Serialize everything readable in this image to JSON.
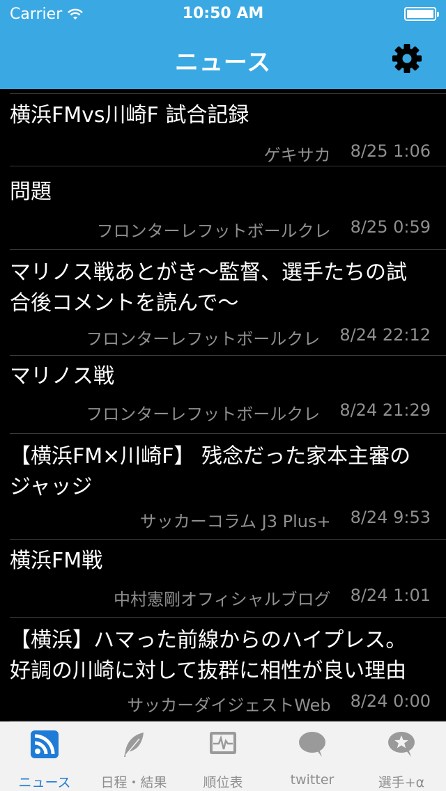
{
  "status_bar": {
    "carrier": "Carrier",
    "time": "10:50 AM"
  },
  "nav": {
    "title": "ニュース",
    "settings_icon": "gear-icon"
  },
  "news": [
    {
      "title": "横浜FMvs川崎F 試合記録",
      "source": "ゲキサカ",
      "date": "8/25 1:06"
    },
    {
      "title": "問題",
      "source": "フロンターレフットボールクレ",
      "date": "8/25 0:59"
    },
    {
      "title_lines": [
        "マリノス戦あとがき〜監督、選手たちの試",
        "合後コメントを読んで〜"
      ],
      "source": "フロンターレフットボールクレ",
      "date": "8/24 22:12"
    },
    {
      "title": "マリノス戦",
      "source": "フロンターレフットボールクレ",
      "date": "8/24 21:29"
    },
    {
      "title_lines": [
        "【横浜FM×川崎F】 残念だった家本主審の",
        "ジャッジ"
      ],
      "source": "サッカーコラム J3 Plus+",
      "date": "8/24 9:53"
    },
    {
      "title": "横浜FM戦",
      "source": "中村憲剛オフィシャルブログ",
      "date": "8/24 1:01"
    },
    {
      "title_lines": [
        "【横浜】ハマった前線からのハイプレス。",
        "好調の川崎に対して抜群に相性が良い理由"
      ],
      "source": "サッカーダイジェストWeb",
      "date": "8/24 0:00"
    }
  ],
  "tabs": [
    {
      "label": "ニュース",
      "icon": "rss-icon",
      "active": true
    },
    {
      "label": "日程・結果",
      "icon": "feather-icon",
      "active": false
    },
    {
      "label": "順位表",
      "icon": "monitor-chart-icon",
      "active": false
    },
    {
      "label": "twitter",
      "icon": "speech-bubble-icon",
      "active": false
    },
    {
      "label": "選手+α",
      "icon": "star-bubble-icon",
      "active": false
    }
  ],
  "colors": {
    "accent": "#3aa9e3",
    "tab_active": "#1e7bd6",
    "tab_inactive": "#8e8e8e",
    "meta_text": "#8f8f8f"
  }
}
